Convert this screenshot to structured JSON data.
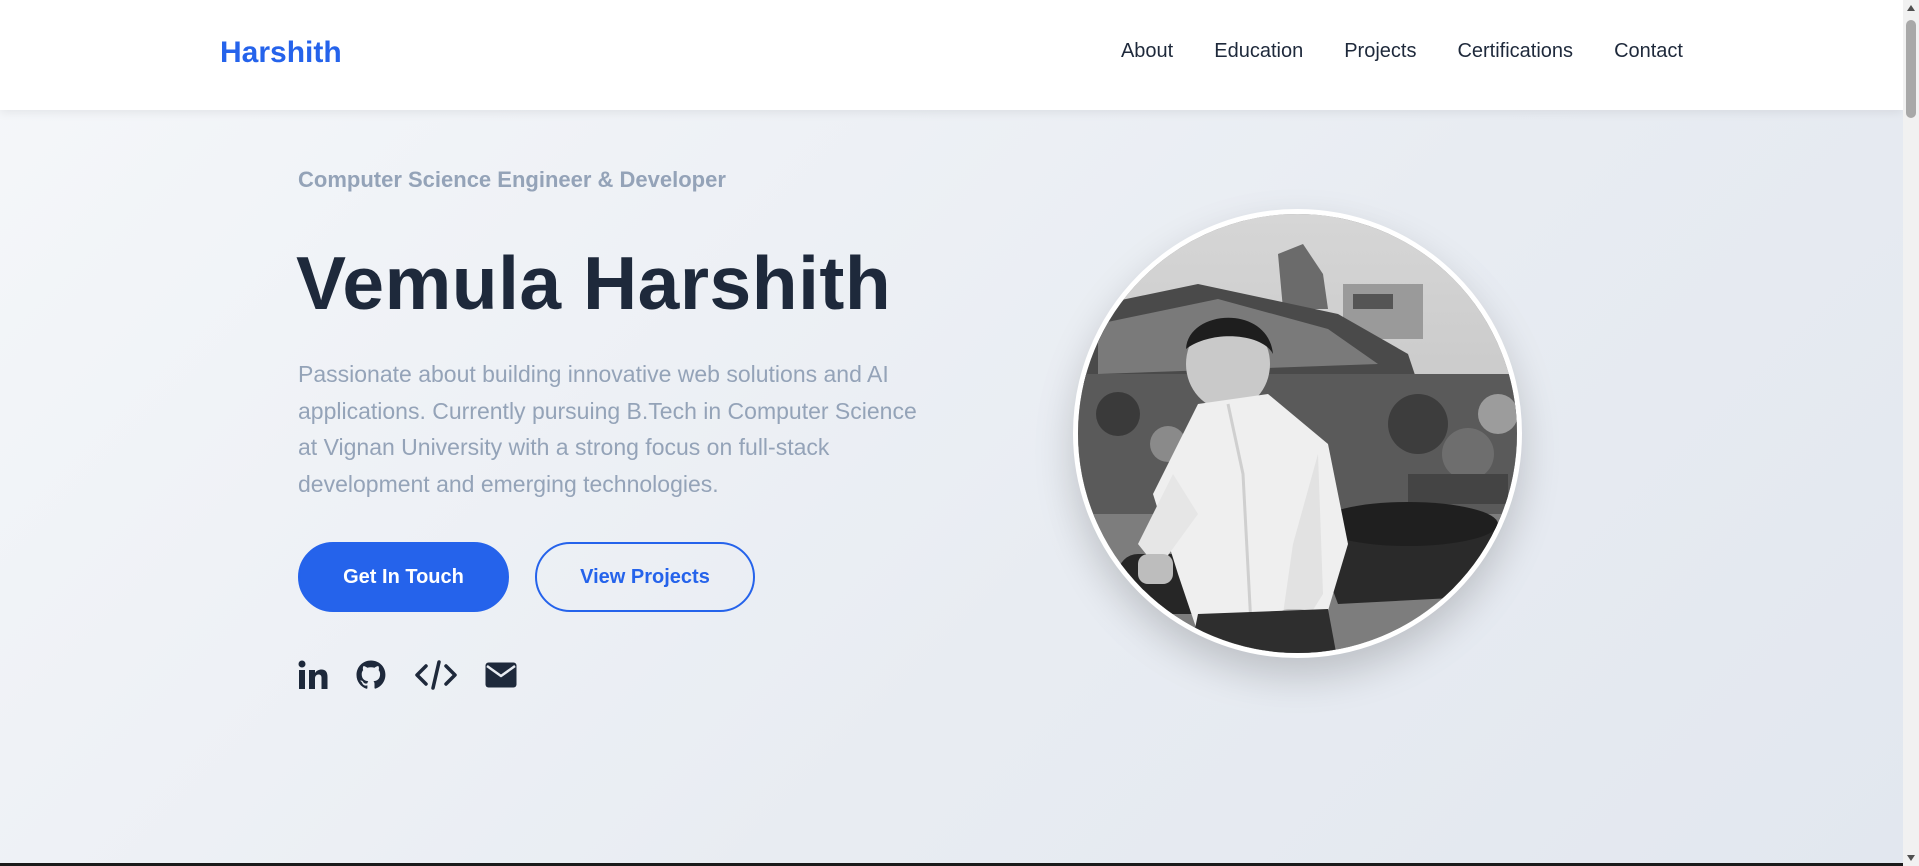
{
  "header": {
    "brand": "Harshith",
    "nav": [
      {
        "label": "About"
      },
      {
        "label": "Education"
      },
      {
        "label": "Projects"
      },
      {
        "label": "Certifications"
      },
      {
        "label": "Contact"
      }
    ]
  },
  "hero": {
    "subtitle": "Computer Science Engineer & Developer",
    "name": "Vemula Harshith",
    "description": "Passionate about building innovative web solutions and AI applications. Currently pursuing B.Tech in Computer Science at Vignan University with a strong focus on full-stack development and emerging technologies.",
    "primary_button": "Get In Touch",
    "secondary_button": "View Projects",
    "socials": [
      {
        "icon": "linkedin-icon"
      },
      {
        "icon": "github-icon"
      },
      {
        "icon": "code-icon"
      },
      {
        "icon": "envelope-icon"
      }
    ]
  },
  "colors": {
    "accent": "#2563eb",
    "heading": "#1e293b",
    "muted": "#94a3b8"
  }
}
